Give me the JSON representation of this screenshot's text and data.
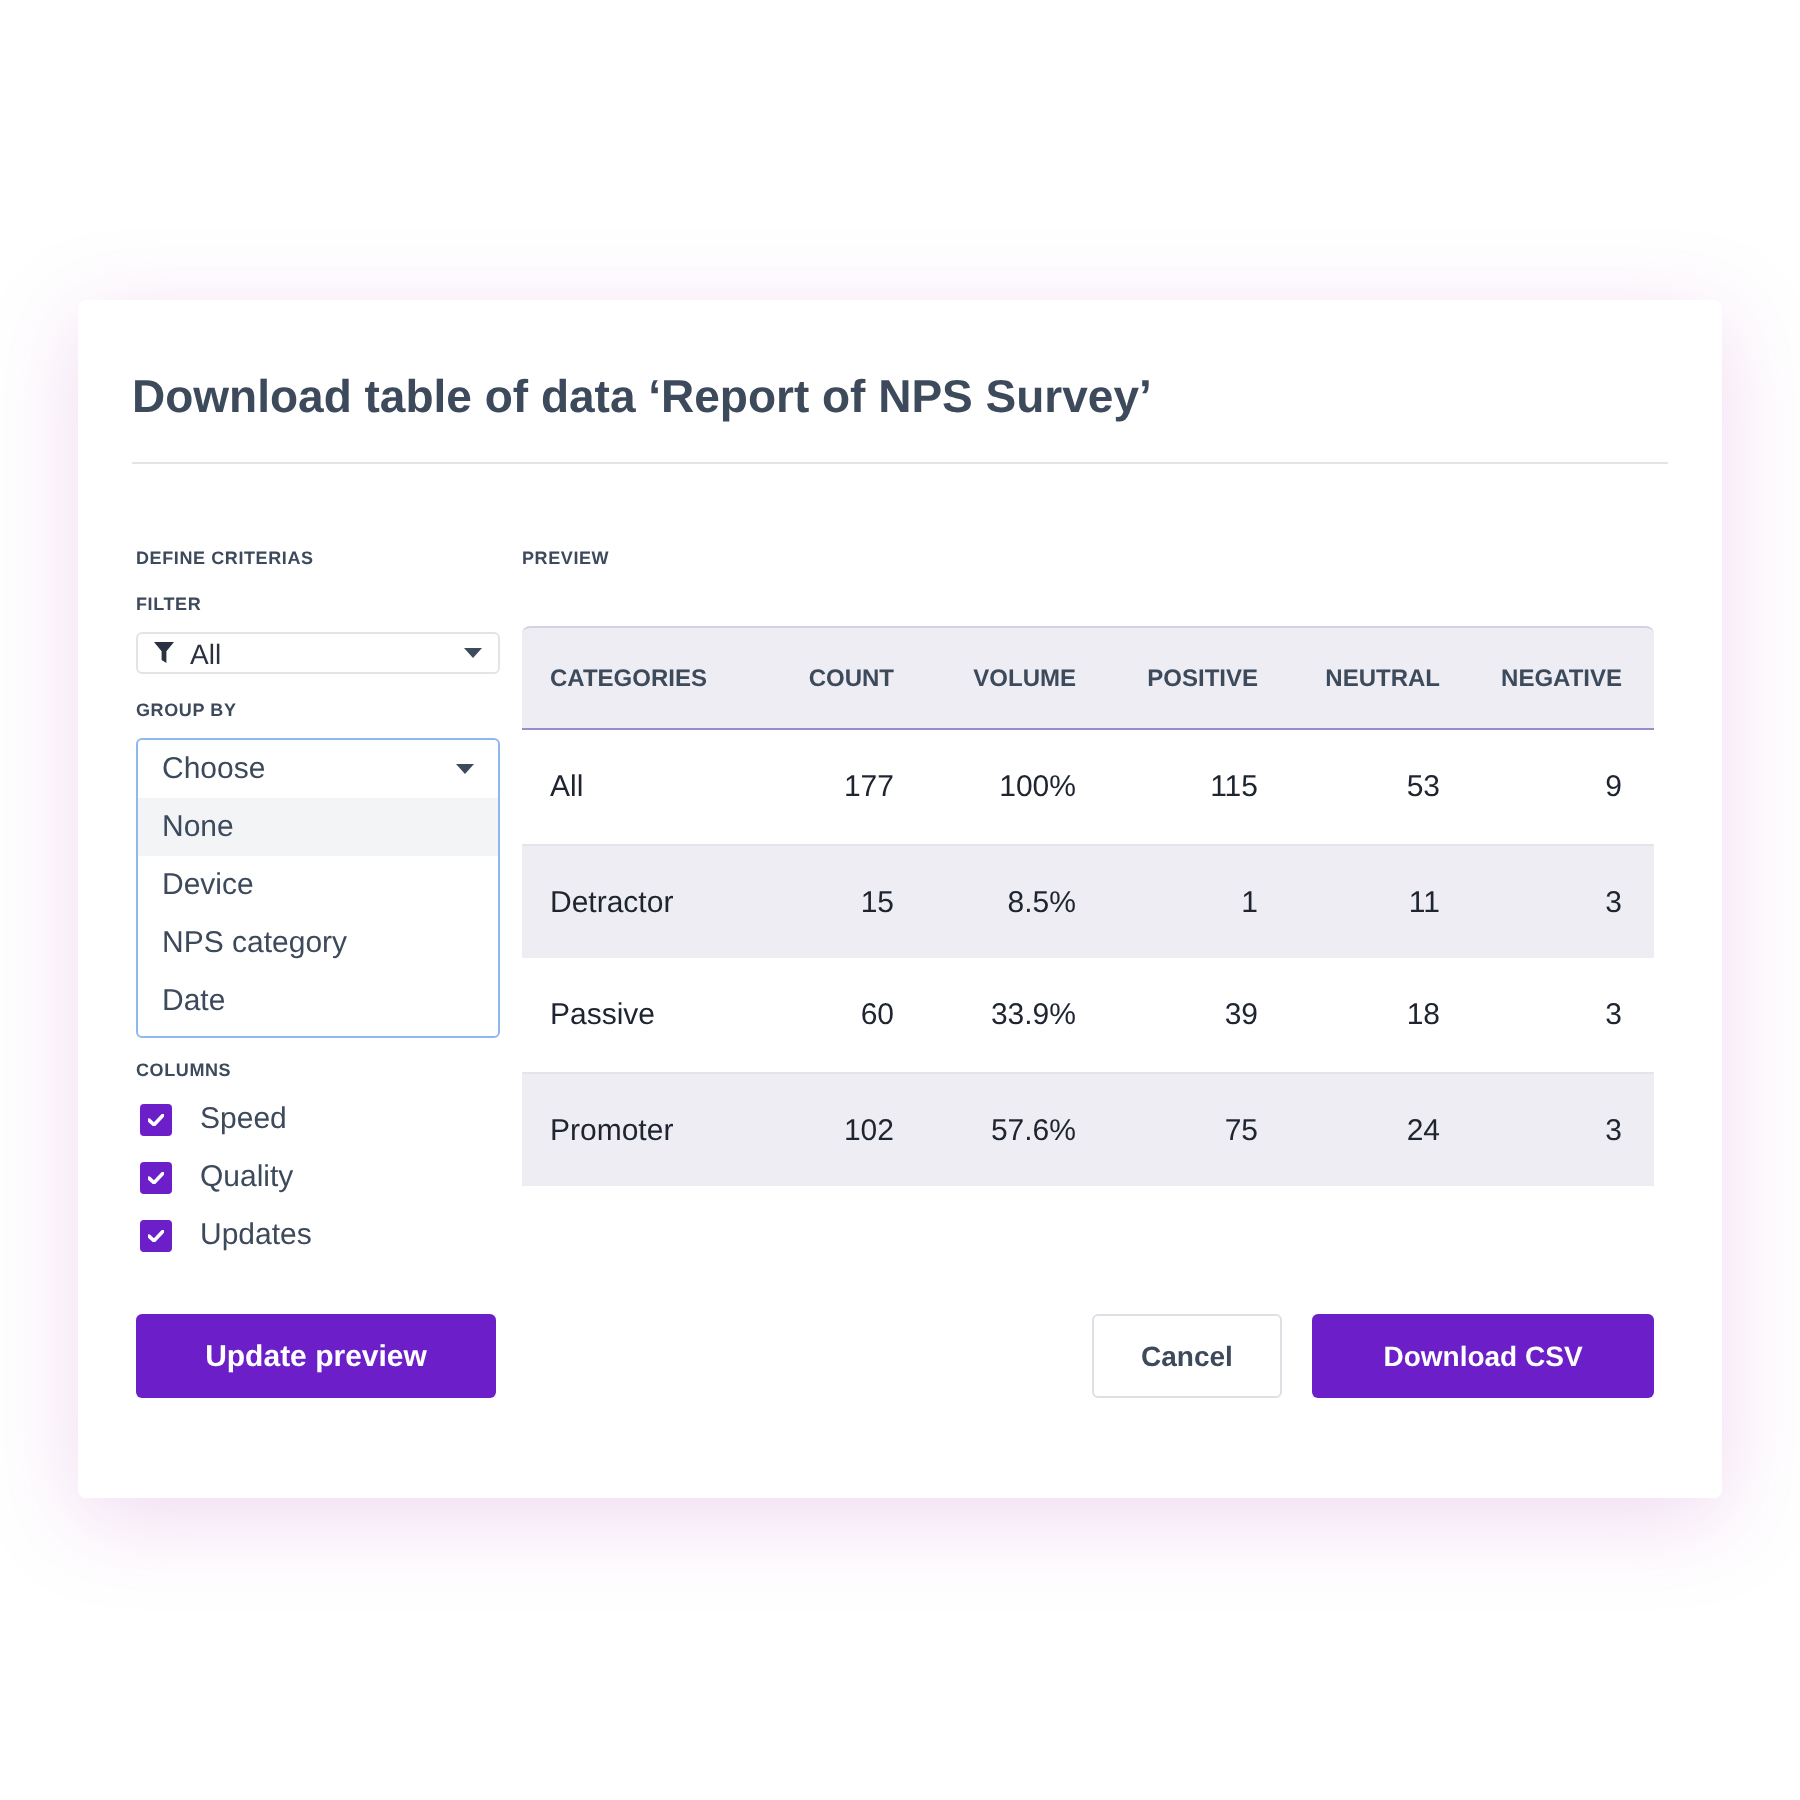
{
  "dialog": {
    "title": "Download table of data ‘Report of NPS Survey’"
  },
  "criteria": {
    "heading": "DEFINE CRITERIAS",
    "filter": {
      "label": "FILTER",
      "value": "All"
    },
    "group_by": {
      "label": "GROUP BY",
      "value": "Choose",
      "expanded": true,
      "options": [
        {
          "label": "None",
          "highlighted": true
        },
        {
          "label": "Device",
          "highlighted": false
        },
        {
          "label": "NPS category",
          "highlighted": false
        },
        {
          "label": "Date",
          "highlighted": false
        }
      ]
    },
    "columns": {
      "label": "COLUMNS",
      "items": [
        {
          "label": "Speed",
          "checked": true
        },
        {
          "label": "Quality",
          "checked": true
        },
        {
          "label": "Updates",
          "checked": true
        }
      ]
    }
  },
  "preview": {
    "heading": "PREVIEW",
    "table": {
      "columns": [
        "CATEGORIES",
        "COUNT",
        "VOLUME",
        "POSITIVE",
        "NEUTRAL",
        "NEGATIVE"
      ],
      "rows": [
        [
          "All",
          "177",
          "100%",
          "115",
          "53",
          "9"
        ],
        [
          "Detractor",
          "15",
          "8.5%",
          "1",
          "11",
          "3"
        ],
        [
          "Passive",
          "60",
          "33.9%",
          "39",
          "18",
          "3"
        ],
        [
          "Promoter",
          "102",
          "57.6%",
          "75",
          "24",
          "3"
        ]
      ]
    }
  },
  "footer": {
    "left": [
      {
        "label": "Update preview",
        "kind": "primary"
      }
    ],
    "right": [
      {
        "label": "Cancel",
        "kind": "secondary"
      },
      {
        "label": "Download CSV",
        "kind": "primary"
      }
    ]
  }
}
